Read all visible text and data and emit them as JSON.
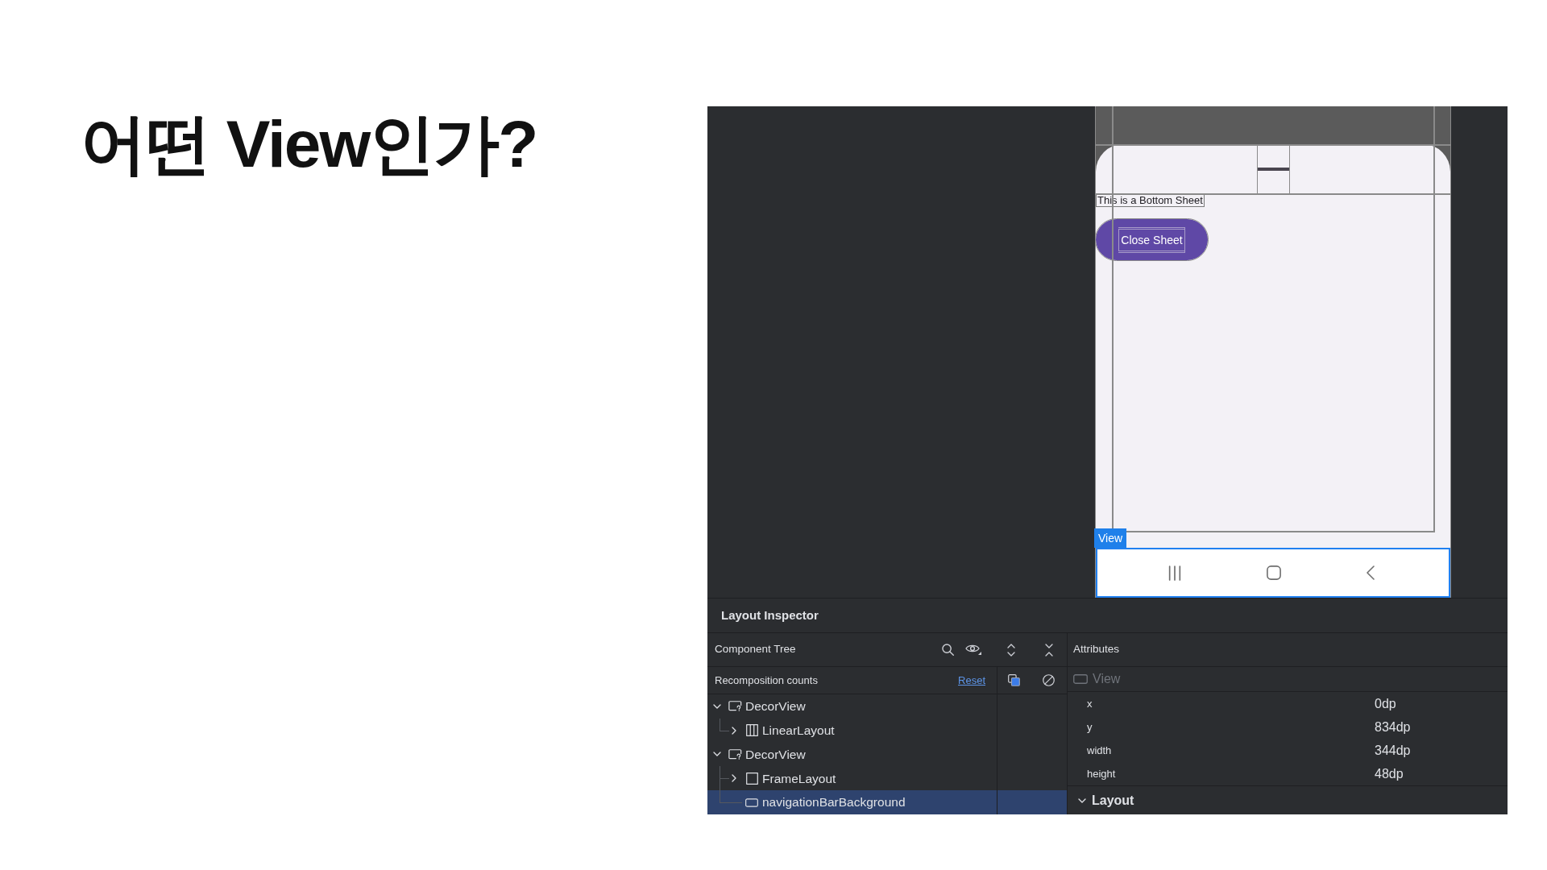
{
  "slide": {
    "title": "어떤 View인가?"
  },
  "device_preview": {
    "sheet_text": "This is a Bottom Sheet",
    "close_button": "Close Sheet",
    "selection_label": "View"
  },
  "layout_inspector": {
    "title": "Layout Inspector",
    "component_tree": {
      "title": "Component Tree",
      "recomposition_label": "Recomposition counts",
      "reset_link": "Reset",
      "nodes": [
        {
          "label": "DecorView",
          "kind": "decor_view",
          "expandable": true,
          "expanded": true,
          "selected": false,
          "children": [
            {
              "label": "LinearLayout",
              "kind": "linear_layout",
              "expandable": true,
              "expanded": false,
              "selected": false
            }
          ]
        },
        {
          "label": "DecorView",
          "kind": "decor_view",
          "expandable": true,
          "expanded": true,
          "selected": false,
          "children": [
            {
              "label": "FrameLayout",
              "kind": "frame_layout",
              "expandable": true,
              "expanded": false,
              "selected": false
            },
            {
              "label": "navigationBarBackground",
              "kind": "view",
              "expandable": false,
              "selected": true
            }
          ]
        }
      ]
    },
    "attributes": {
      "title": "Attributes",
      "selected_view": "View",
      "rows": [
        {
          "name": "x",
          "value": "0dp"
        },
        {
          "name": "y",
          "value": "834dp"
        },
        {
          "name": "width",
          "value": "344dp"
        },
        {
          "name": "height",
          "value": "48dp"
        }
      ],
      "section": {
        "label": "Layout",
        "expanded": true
      }
    }
  }
}
